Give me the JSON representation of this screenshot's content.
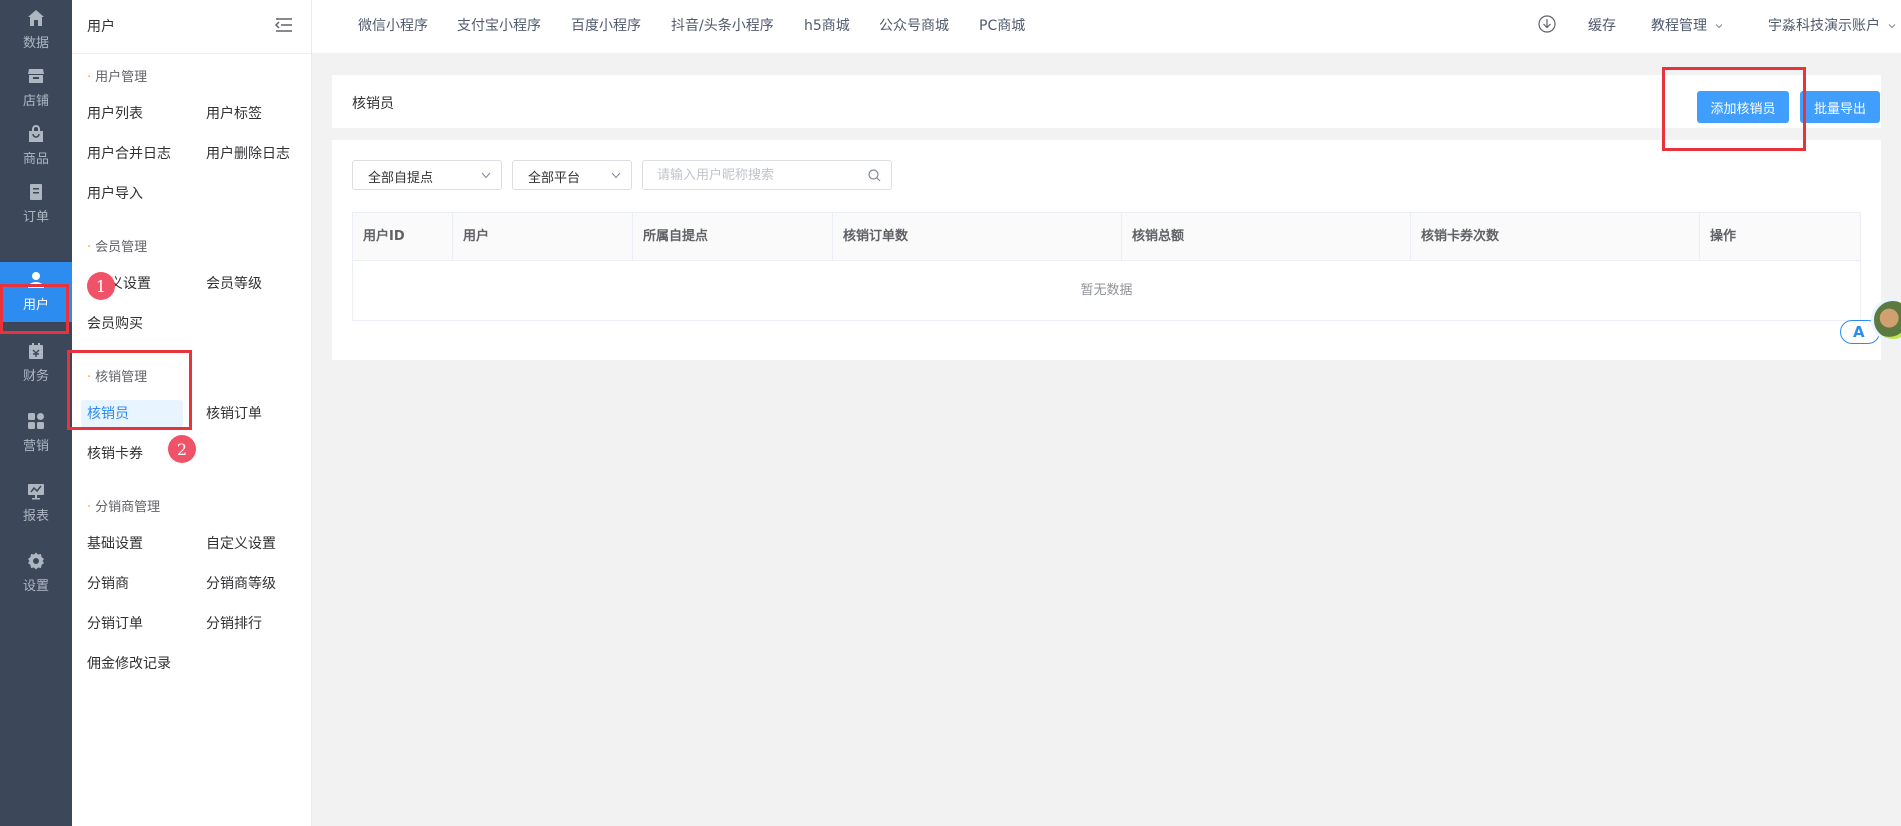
{
  "rail": {
    "items": [
      {
        "label": "数据",
        "icon": "home-icon"
      },
      {
        "label": "店铺",
        "icon": "store-icon"
      },
      {
        "label": "商品",
        "icon": "bag-icon"
      },
      {
        "label": "订单",
        "icon": "order-icon"
      },
      {
        "label": "用户",
        "icon": "user-icon",
        "active": true
      },
      {
        "label": "财务",
        "icon": "finance-icon"
      },
      {
        "label": "营销",
        "icon": "grid-icon"
      },
      {
        "label": "报表",
        "icon": "chart-icon"
      },
      {
        "label": "设置",
        "icon": "gear-icon"
      }
    ]
  },
  "submenu": {
    "title": "用户",
    "groups": [
      {
        "title": "用户管理",
        "items": [
          "用户列表",
          "用户标签",
          "用户合并日志",
          "用户删除日志",
          "用户导入"
        ]
      },
      {
        "title": "会员管理",
        "items": [
          "义设置",
          "会员等级",
          "会员购买"
        ]
      },
      {
        "title": "核销管理",
        "items": [
          "核销员",
          "核销订单",
          "核销卡券"
        ]
      },
      {
        "title": "分销商管理",
        "items": [
          "基础设置",
          "自定义设置",
          "分销商",
          "分销商等级",
          "分销订单",
          "分销排行",
          "佣金修改记录"
        ]
      }
    ],
    "selected": "核销员"
  },
  "annotations": {
    "badge1": "1",
    "badge2": "2"
  },
  "topbar": {
    "links": [
      "微信小程序",
      "支付宝小程序",
      "百度小程序",
      "抖音/头条小程序",
      "h5商城",
      "公众号商城",
      "PC商城"
    ],
    "cache": "缓存",
    "tutorial": "教程管理",
    "account": "宇淼科技演示账户"
  },
  "page": {
    "title": "核销员",
    "add_button": "添加核销员",
    "export_button": "批量导出"
  },
  "filters": {
    "pickup_point": "全部自提点",
    "platform": "全部平台",
    "search_placeholder": "请输入用户昵称搜索"
  },
  "table": {
    "columns": [
      "用户ID",
      "用户",
      "所属自提点",
      "核销订单数",
      "核销总额",
      "核销卡券次数",
      "操作"
    ],
    "empty_text": "暂无数据"
  },
  "floating": {
    "translate_label": "A"
  },
  "colors": {
    "accent": "#409eff",
    "rail_bg": "#3c4759",
    "rail_active": "#2d8cf0",
    "highlight": "#e8333d"
  }
}
